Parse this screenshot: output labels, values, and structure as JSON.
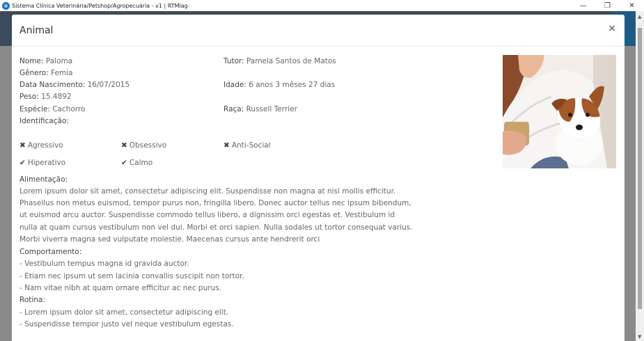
{
  "window": {
    "title": "Sistema Clínica Veterinária/Petshop/Agropecuária - v1 | RTMlag",
    "minimize": "—",
    "restore": "❐",
    "close": "✕"
  },
  "modal": {
    "title": "Animal",
    "close": "×"
  },
  "animal": {
    "nome_label": "Nome:",
    "nome": "Paloma",
    "genero_label": "Gênero:",
    "genero": "Femia",
    "nascimento_label": "Data Nascimento:",
    "nascimento": "16/07/2015",
    "peso_label": "Peso:",
    "peso": "15.4892",
    "especie_label": "Espécie:",
    "especie": "Cachorro",
    "identificacao_label": "Identificação:",
    "tutor_label": "Tutor:",
    "tutor": "Pamela Santos de Matos",
    "idade_label": "Idade:",
    "idade": "6 anos 3 mêses 27 dias",
    "raca_label": "Raça:",
    "raca": "Russell Terrier"
  },
  "traits": [
    {
      "icon": "✖",
      "label": "Agressivo"
    },
    {
      "icon": "✖",
      "label": "Obsessivo"
    },
    {
      "icon": "✖",
      "label": "Anti-Social"
    },
    {
      "icon": "✔",
      "label": "Hiperativo"
    },
    {
      "icon": "✔",
      "label": "Calmo"
    }
  ],
  "alimentacao": {
    "title": "Alimentação:",
    "text": "Lorem ipsum dolor sit amet, consectetur adipiscing elit. Suspendisse non magna at nisi mollis efficitur. Phasellus non metus euismod, tempor purus non, fringilla libero. Donec auctor tellus nec ipsum bibendum, ut euismod arcu auctor. Suspendisse commodo tellus libero, a dignissim orci egestas et. Vestibulum id nulla at quam cursus vestibulum non vel dui. Morbi et orci sapien. Nulla sodales ut tortor consequat varius. Morbi viverra magna sed vulputate molestie. Maecenas cursus ante hendrerit orci"
  },
  "comportamento": {
    "title": "Comportamento:",
    "items": [
      "- Vestibulum tempus magna id gravida auctor.",
      "- Etiam nec ipsum ut sem lacinia convallis suscipit non tortor.",
      "- Nam vitae nibh at quam ornare efficitur ac nec purus."
    ]
  },
  "rotina": {
    "title": "Rotina:",
    "items": [
      "- Lorem ipsum dolor sit amet, consectetur adipiscing elit.",
      "- Suspendisse tempor justo vel neque vestibulum egestas."
    ]
  }
}
